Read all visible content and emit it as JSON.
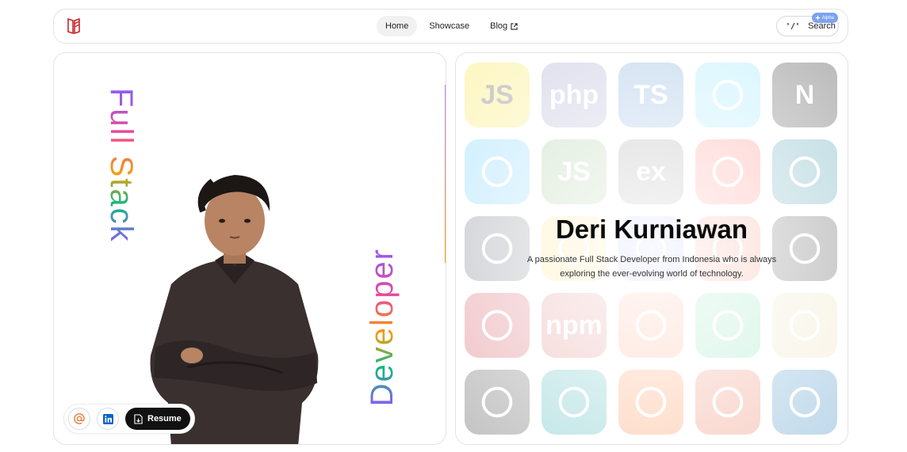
{
  "nav": {
    "links": [
      {
        "label": "Home",
        "active": true
      },
      {
        "label": "Showcase",
        "active": false
      },
      {
        "label": "Blog",
        "active": false,
        "external": true
      }
    ],
    "search": {
      "key": "'/'",
      "label": "Search",
      "badge": "Alpha"
    }
  },
  "hero": {
    "title_vertical_1": "Full Stack",
    "title_vertical_2": "Developer",
    "name": "Deri Kurniawan",
    "description_line1": "A passionate Full Stack Developer from Indonesia who is always",
    "description_line2": "exploring the ever-evolving world of technology."
  },
  "actions": {
    "email_icon": "at-icon",
    "linkedin_icon": "linkedin-icon",
    "resume_label": "Resume"
  },
  "tech_icons": [
    {
      "name": "javascript-icon",
      "text": "JS",
      "color": "#f7df1e"
    },
    {
      "name": "php-icon",
      "text": "php",
      "color": "#777bb4"
    },
    {
      "name": "typescript-icon",
      "text": "TS",
      "color": "#3178c6"
    },
    {
      "name": "react-icon",
      "text": "",
      "color": "#61dafb"
    },
    {
      "name": "nextjs-icon",
      "text": "N",
      "color": "#000000"
    },
    {
      "name": "tailwind-icon",
      "text": "",
      "color": "#38bdf8"
    },
    {
      "name": "nodejs-icon",
      "text": "JS",
      "color": "#5fa04e"
    },
    {
      "name": "express-icon",
      "text": "ex",
      "color": "#444444"
    },
    {
      "name": "laravel-icon",
      "text": "",
      "color": "#ff2d20"
    },
    {
      "name": "mysql-icon",
      "text": "",
      "color": "#00758f"
    },
    {
      "name": "prisma-icon",
      "text": "",
      "color": "#2d3748"
    },
    {
      "name": "firebase-icon",
      "text": "",
      "color": "#ffca28"
    },
    {
      "name": "vite-icon",
      "text": "",
      "color": "#646cff"
    },
    {
      "name": "git-icon",
      "text": "",
      "color": "#f05032"
    },
    {
      "name": "vercel-icon",
      "text": "",
      "color": "#000000"
    },
    {
      "name": "jest-icon",
      "text": "",
      "color": "#c21325"
    },
    {
      "name": "npm-icon",
      "text": "npm",
      "color": "#cb3837"
    },
    {
      "name": "postman-icon",
      "text": "",
      "color": "#ff6c37"
    },
    {
      "name": "supabase-icon",
      "text": "",
      "color": "#3ecf8e"
    },
    {
      "name": "mascot-icon",
      "text": "",
      "color": "#e6d5a3"
    },
    {
      "name": "unity-icon",
      "text": "",
      "color": "#222222"
    },
    {
      "name": "arduino-icon",
      "text": "",
      "color": "#00979d"
    },
    {
      "name": "astro-icon",
      "text": "",
      "color": "#ff5d01"
    },
    {
      "name": "html5-icon",
      "text": "",
      "color": "#e34f26"
    },
    {
      "name": "css3-icon",
      "text": "",
      "color": "#1572b6"
    }
  ]
}
